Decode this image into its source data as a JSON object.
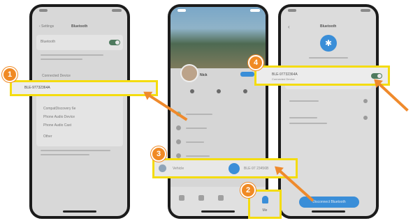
{
  "screens": [
    {
      "title": "Bluetooth",
      "toggle_label": "Bluetooth",
      "section_label": "Connected Device",
      "highlighted_device": "BLE-97732364A",
      "other_devices": [
        "CompatDiscovery 6e",
        "Phone Audio Device",
        "Phone Audio Cast",
        "Other"
      ]
    },
    {
      "profile_name": "Nick",
      "nav_label": "Me",
      "list_left": "Vehicle",
      "list_right": "BLE-97 23456B"
    },
    {
      "title": "Bluetooth",
      "device_name": "BLE-97732364A",
      "device_sub": "Connected Device",
      "bottom_button": "Disconnect Bluetooth"
    }
  ],
  "steps": [
    "1",
    "2",
    "3",
    "4"
  ],
  "colors": {
    "highlight": "#f4dc0f",
    "badge": "#f08a24",
    "arrow": "#ef8a2c",
    "toggle_on": "#4e7a5e",
    "accent_blue": "#3a8ed8"
  }
}
